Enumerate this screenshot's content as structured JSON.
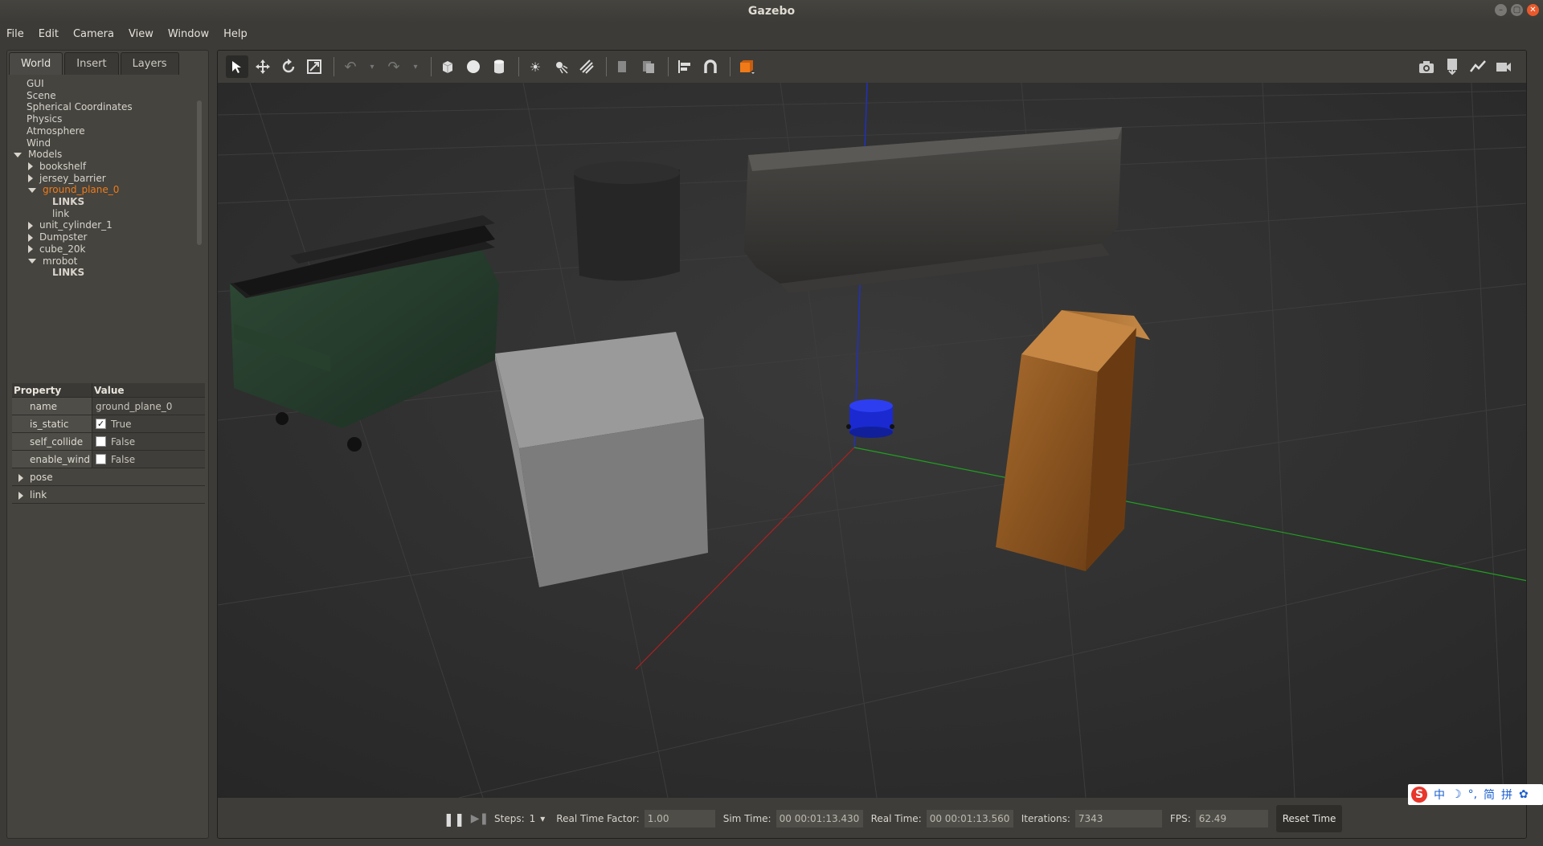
{
  "window": {
    "title": "Gazebo"
  },
  "menu": [
    "File",
    "Edit",
    "Camera",
    "View",
    "Window",
    "Help"
  ],
  "left_panel": {
    "tabs": [
      "World",
      "Insert",
      "Layers"
    ],
    "tree": [
      {
        "label": "GUI",
        "level": 1,
        "expander": "none"
      },
      {
        "label": "Scene",
        "level": 1,
        "expander": "none"
      },
      {
        "label": "Spherical Coordinates",
        "level": 1,
        "expander": "none"
      },
      {
        "label": "Physics",
        "level": 1,
        "expander": "none"
      },
      {
        "label": "Atmosphere",
        "level": 1,
        "expander": "none"
      },
      {
        "label": "Wind",
        "level": 1,
        "expander": "none"
      },
      {
        "label": "Models",
        "level": 0,
        "expander": "down"
      },
      {
        "label": "bookshelf",
        "level": 2,
        "expander": "right"
      },
      {
        "label": "jersey_barrier",
        "level": 2,
        "expander": "right"
      },
      {
        "label": "ground_plane_0",
        "level": 2,
        "expander": "down",
        "selected": true
      },
      {
        "label": "LINKS",
        "level": 3,
        "expander": "none",
        "bold": true
      },
      {
        "label": "link",
        "level": 3,
        "expander": "none"
      },
      {
        "label": "unit_cylinder_1",
        "level": 2,
        "expander": "right"
      },
      {
        "label": "Dumpster",
        "level": 2,
        "expander": "right"
      },
      {
        "label": "cube_20k",
        "level": 2,
        "expander": "right"
      },
      {
        "label": "mrobot",
        "level": 2,
        "expander": "down"
      },
      {
        "label": "LINKS",
        "level": 3,
        "expander": "none",
        "bold": true
      }
    ],
    "properties": {
      "header": {
        "property": "Property",
        "value": "Value"
      },
      "rows": [
        {
          "key": "name",
          "value": "ground_plane_0",
          "checkbox": null
        },
        {
          "key": "is_static",
          "value": "True",
          "checkbox": true
        },
        {
          "key": "self_collide",
          "value": "False",
          "checkbox": false
        },
        {
          "key": "enable_wind",
          "value": "False",
          "checkbox": false
        }
      ],
      "expandable": [
        "pose",
        "link"
      ]
    }
  },
  "bottom_bar": {
    "steps_label": "Steps:",
    "steps_value": "1",
    "rtf_label": "Real Time Factor:",
    "rtf_value": "1.00",
    "sim_time_label": "Sim Time:",
    "sim_time_value": "00 00:01:13.430",
    "real_time_label": "Real Time:",
    "real_time_value": "00 00:01:13.560",
    "iterations_label": "Iterations:",
    "iterations_value": "7343",
    "fps_label": "FPS:",
    "fps_value": "62.49",
    "reset_label": "Reset Time"
  },
  "ime": [
    "S",
    "中",
    "☽",
    "°,",
    "简",
    "拼",
    "✿"
  ],
  "colors": {
    "selected_item": "#f07a18",
    "axis_x": "#b02020",
    "axis_y": "#20a020",
    "axis_z": "#2030c0",
    "robot": "#1a2ad0"
  }
}
